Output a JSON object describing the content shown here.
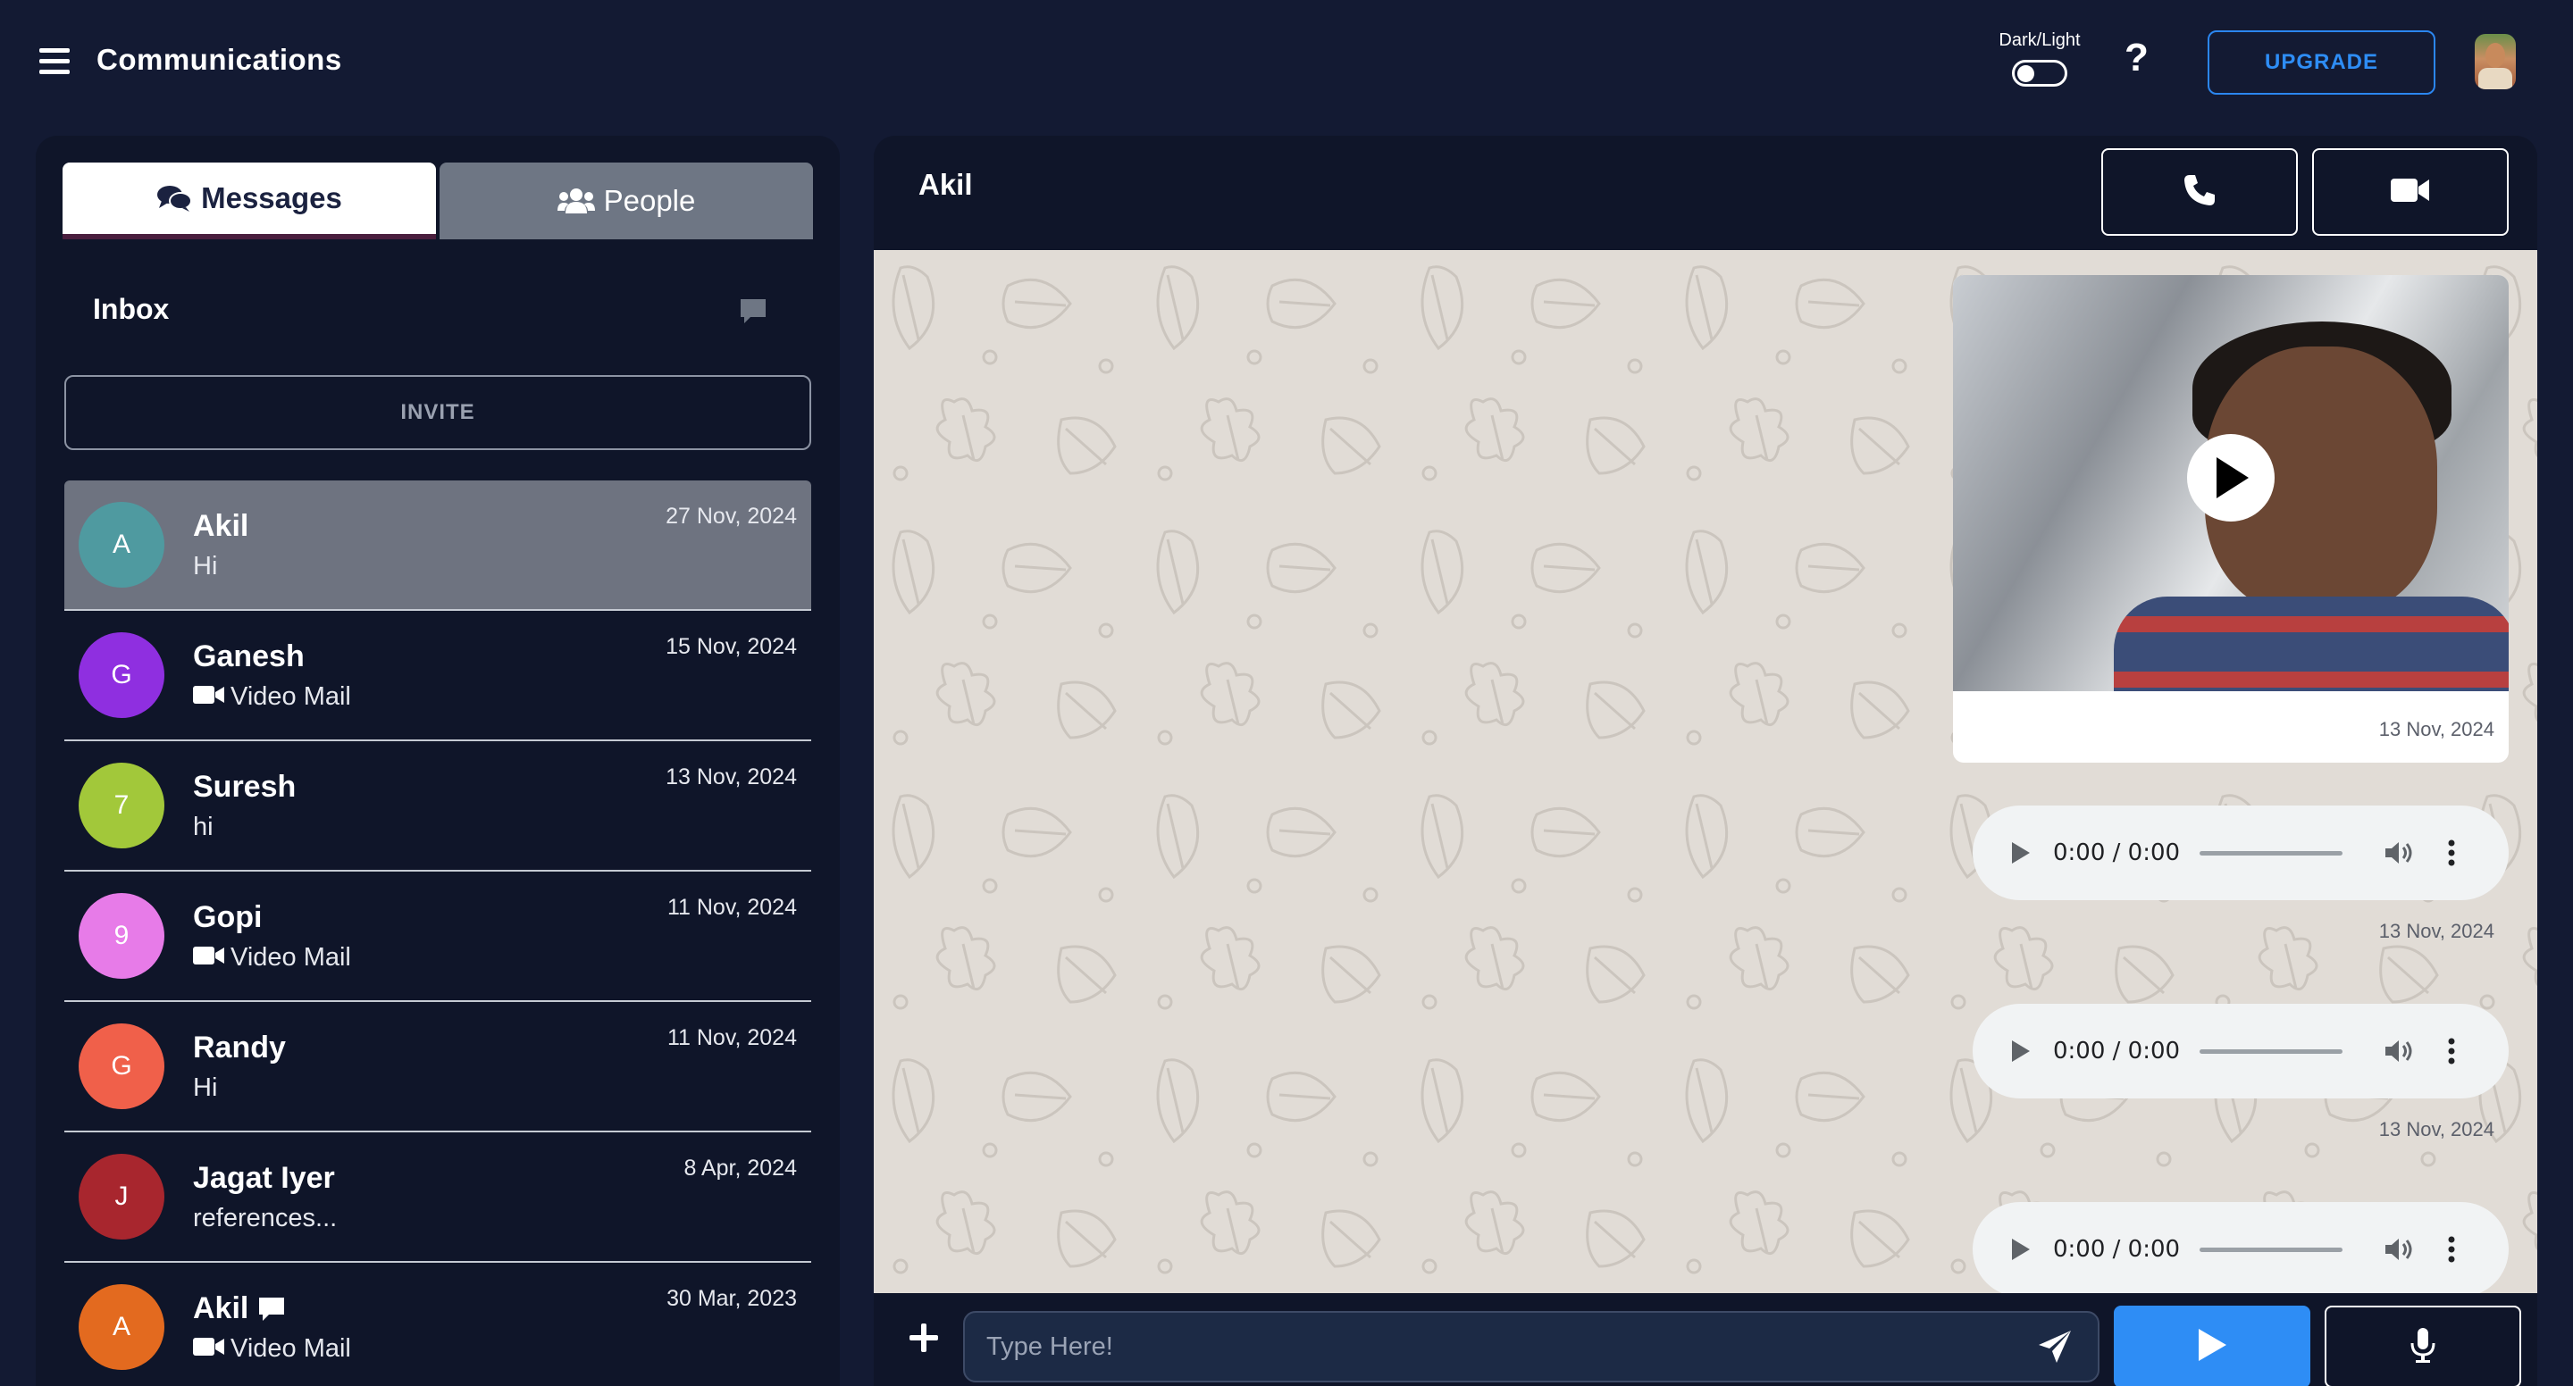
{
  "app": {
    "title": "Communications"
  },
  "topbar": {
    "theme_label": "Dark/Light",
    "help_label": "?",
    "upgrade_label": "UPGRADE"
  },
  "sidebar": {
    "tabs": [
      {
        "label": "Messages",
        "icon": "comments-icon",
        "active": true
      },
      {
        "label": "People",
        "icon": "users-icon",
        "active": false
      }
    ],
    "inbox_label": "Inbox",
    "invite_label": "INVITE",
    "conversations": [
      {
        "initial": "A",
        "name": "Akil",
        "preview": "Hi",
        "date": "27 Nov, 2024",
        "color": "#4f9aa0",
        "video_mail": false,
        "active": true
      },
      {
        "initial": "G",
        "name": "Ganesh",
        "preview": "Video Mail",
        "date": "15 Nov, 2024",
        "color": "#8f2fe0",
        "video_mail": true
      },
      {
        "initial": "7",
        "name": "Suresh",
        "preview": "hi",
        "date": "13 Nov, 2024",
        "color": "#a2c83a",
        "video_mail": false
      },
      {
        "initial": "9",
        "name": "Gopi",
        "preview": "Video Mail",
        "date": "11 Nov, 2024",
        "color": "#e77be8",
        "video_mail": true
      },
      {
        "initial": "G",
        "name": "Randy",
        "preview": "Hi",
        "date": "11 Nov, 2024",
        "color": "#f0604a",
        "video_mail": false
      },
      {
        "initial": "J",
        "name": "Jagat Iyer",
        "preview": "references...",
        "date": "8 Apr, 2024",
        "color": "#a8262e",
        "video_mail": false
      },
      {
        "initial": "A",
        "name": "Akil",
        "preview": "Video Mail",
        "date": "30 Mar, 2023",
        "color": "#e36a1f",
        "video_mail": true,
        "chat_badge": true
      }
    ]
  },
  "chat": {
    "contact_name": "Akil",
    "messages": [
      {
        "type": "video",
        "date": "13 Nov, 2024"
      },
      {
        "type": "audio",
        "time": "0:00 / 0:00",
        "date": "13 Nov, 2024"
      },
      {
        "type": "audio",
        "time": "0:00 / 0:00",
        "date": "13 Nov, 2024"
      },
      {
        "type": "audio",
        "time": "0:00 / 0:00"
      }
    ],
    "input_placeholder": "Type Here!"
  },
  "colors": {
    "background": "#131a33",
    "panel": "#0f1529",
    "accent": "#2e8df5",
    "chat_background": "#e1dcd6"
  }
}
